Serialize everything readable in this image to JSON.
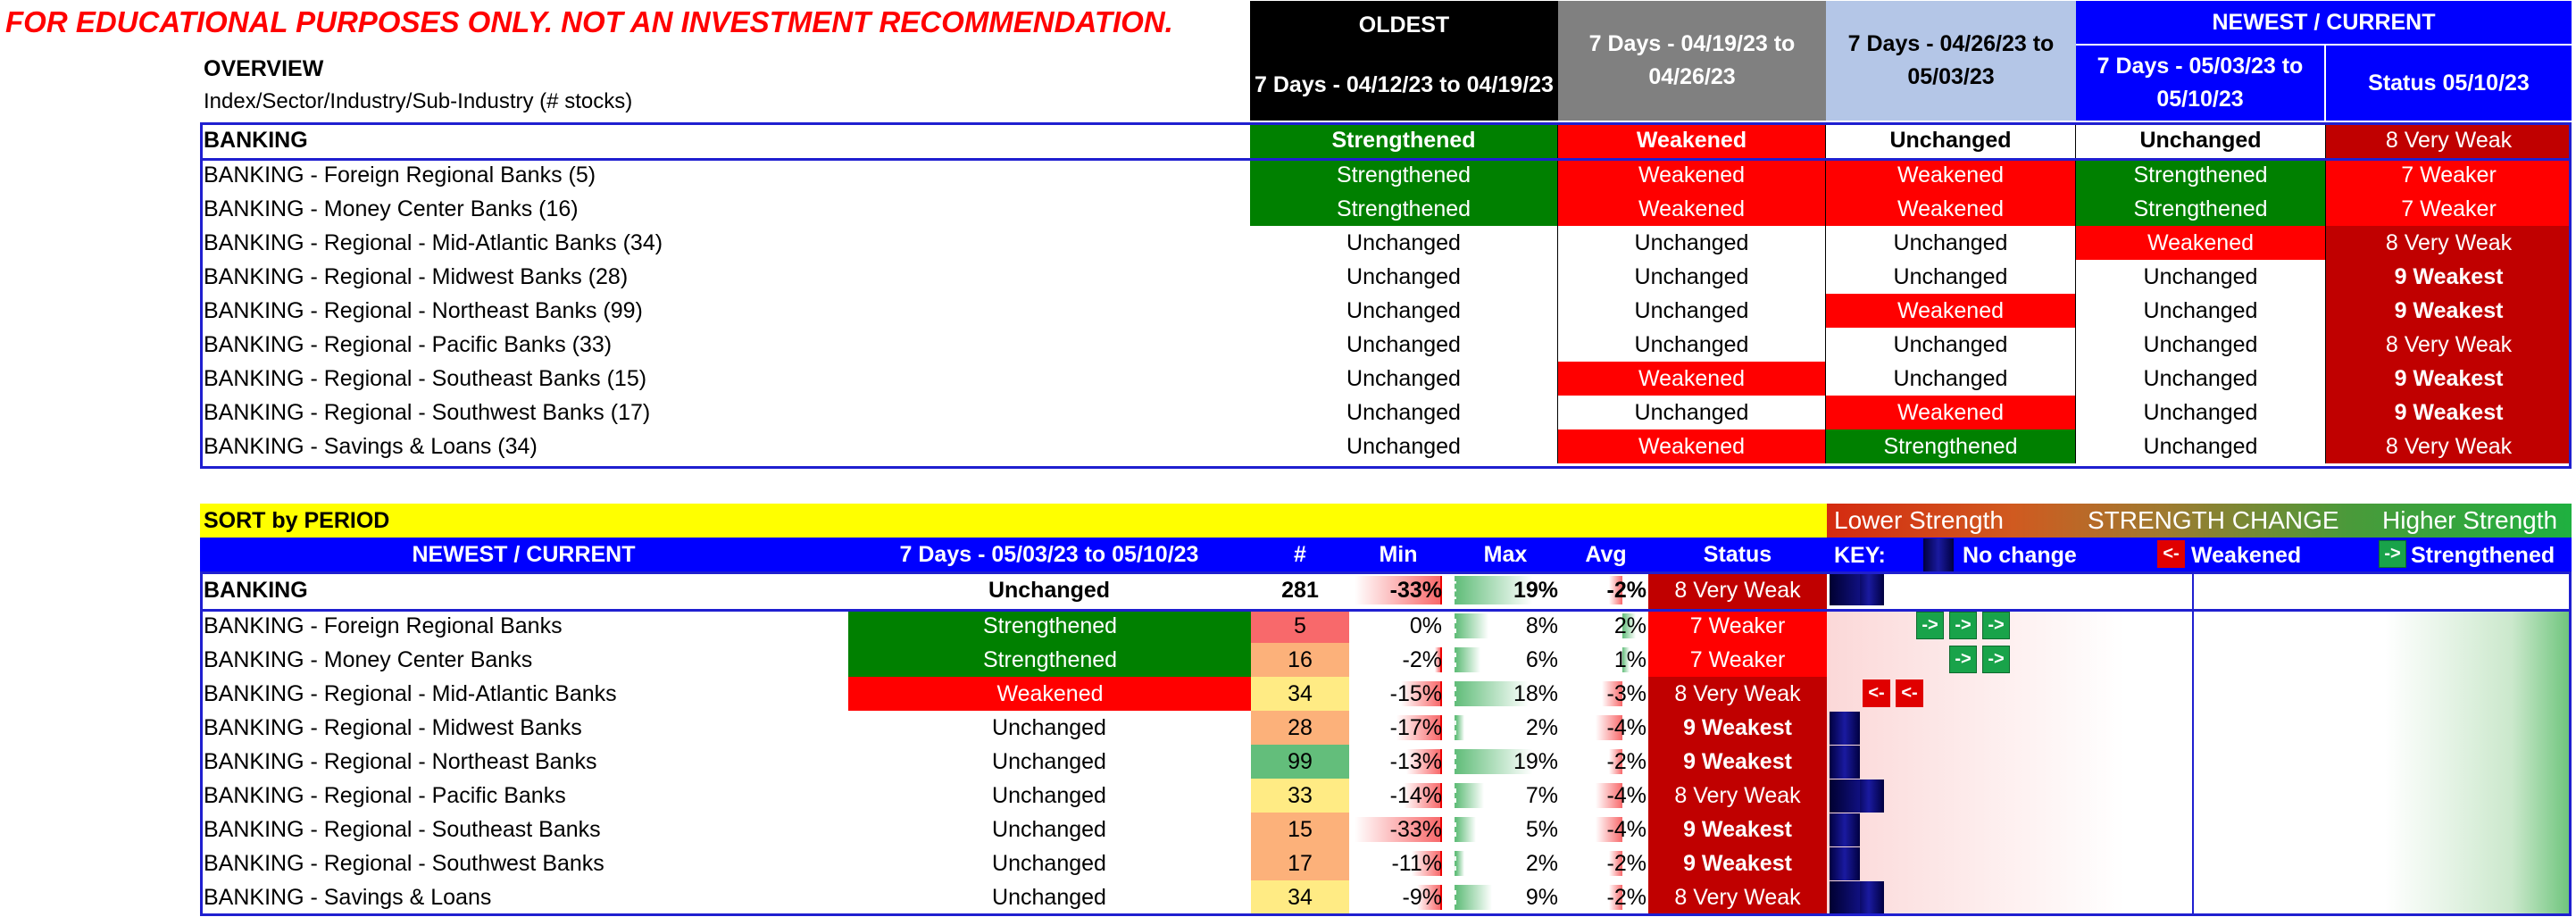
{
  "disclaimer": "FOR EDUCATIONAL PURPOSES ONLY. NOT AN INVESTMENT RECOMMENDATION.",
  "overview": {
    "title": "OVERVIEW",
    "subtitle": "Index/Sector/Industry/Sub-Industry (# stocks)",
    "oldest_label": "OLDEST",
    "newest_label": "NEWEST / CURRENT",
    "periods": [
      "7 Days - 04/12/23 to 04/19/23",
      "7 Days - 04/19/23 to 04/26/23",
      "7 Days - 04/26/23 to 05/03/23",
      "7 Days - 05/03/23 to 05/10/23"
    ],
    "status_header": "Status 05/10/23",
    "rows": [
      {
        "name": "BANKING",
        "p1": "Strengthened",
        "p2": "Weakened",
        "p3": "Unchanged",
        "p4": "Unchanged",
        "status": "8 Very Weak"
      },
      {
        "name": "BANKING - Foreign Regional Banks (5)",
        "p1": "Strengthened",
        "p2": "Weakened",
        "p3": "Weakened",
        "p4": "Strengthened",
        "status": "7 Weaker"
      },
      {
        "name": "BANKING - Money Center Banks (16)",
        "p1": "Strengthened",
        "p2": "Weakened",
        "p3": "Weakened",
        "p4": "Strengthened",
        "status": "7 Weaker"
      },
      {
        "name": "BANKING - Regional - Mid-Atlantic Banks (34)",
        "p1": "Unchanged",
        "p2": "Unchanged",
        "p3": "Unchanged",
        "p4": "Weakened",
        "status": "8 Very Weak"
      },
      {
        "name": "BANKING - Regional - Midwest Banks (28)",
        "p1": "Unchanged",
        "p2": "Unchanged",
        "p3": "Unchanged",
        "p4": "Unchanged",
        "status": "9 Weakest"
      },
      {
        "name": "BANKING - Regional - Northeast Banks (99)",
        "p1": "Unchanged",
        "p2": "Unchanged",
        "p3": "Weakened",
        "p4": "Unchanged",
        "status": "9 Weakest"
      },
      {
        "name": "BANKING - Regional - Pacific Banks (33)",
        "p1": "Unchanged",
        "p2": "Unchanged",
        "p3": "Unchanged",
        "p4": "Unchanged",
        "status": "8 Very Weak"
      },
      {
        "name": "BANKING - Regional - Southeast Banks (15)",
        "p1": "Unchanged",
        "p2": "Weakened",
        "p3": "Unchanged",
        "p4": "Unchanged",
        "status": "9 Weakest"
      },
      {
        "name": "BANKING - Regional - Southwest Banks (17)",
        "p1": "Unchanged",
        "p2": "Unchanged",
        "p3": "Weakened",
        "p4": "Unchanged",
        "status": "9 Weakest"
      },
      {
        "name": "BANKING - Savings & Loans (34)",
        "p1": "Unchanged",
        "p2": "Weakened",
        "p3": "Strengthened",
        "p4": "Unchanged",
        "status": "8 Very Weak"
      }
    ]
  },
  "sort": {
    "title": "SORT by PERIOD",
    "strength": {
      "lower": "Lower Strength",
      "change": "STRENGTH CHANGE",
      "higher": "Higher Strength"
    },
    "headers": {
      "name": "NEWEST / CURRENT",
      "period": "7 Days - 05/03/23 to 05/10/23",
      "count": "#",
      "min": "Min",
      "max": "Max",
      "avg": "Avg",
      "status": "Status"
    },
    "key": {
      "label": "KEY:",
      "no_change": "No change",
      "weakened_arrow": "<-",
      "weakened": "Weakened",
      "strengthened_arrow": "->",
      "strengthened": "Strengthened"
    },
    "rows": [
      {
        "name": "BANKING",
        "period": "Unchanged",
        "count": "281",
        "min": "-33%",
        "max": "19%",
        "avg": "-2%",
        "status": "8 Very Weak",
        "arrows": ""
      },
      {
        "name": "BANKING - Foreign Regional Banks",
        "period": "Strengthened",
        "count": "5",
        "min": "0%",
        "max": "8%",
        "avg": "2%",
        "status": "7 Weaker",
        "arrows": "->"
      },
      {
        "name": "BANKING - Money Center Banks",
        "period": "Strengthened",
        "count": "16",
        "min": "-2%",
        "max": "6%",
        "avg": "1%",
        "status": "7 Weaker",
        "arrows": "->"
      },
      {
        "name": "BANKING - Regional - Mid-Atlantic Banks",
        "period": "Weakened",
        "count": "34",
        "min": "-15%",
        "max": "18%",
        "avg": "-3%",
        "status": "8 Very Weak",
        "arrows": "<-"
      },
      {
        "name": "BANKING - Regional - Midwest Banks",
        "period": "Unchanged",
        "count": "28",
        "min": "-17%",
        "max": "2%",
        "avg": "-4%",
        "status": "9 Weakest",
        "arrows": ""
      },
      {
        "name": "BANKING - Regional - Northeast Banks",
        "period": "Unchanged",
        "count": "99",
        "min": "-13%",
        "max": "19%",
        "avg": "-2%",
        "status": "9 Weakest",
        "arrows": ""
      },
      {
        "name": "BANKING - Regional - Pacific Banks",
        "period": "Unchanged",
        "count": "33",
        "min": "-14%",
        "max": "7%",
        "avg": "-4%",
        "status": "8 Very Weak",
        "arrows": ""
      },
      {
        "name": "BANKING - Regional - Southeast Banks",
        "period": "Unchanged",
        "count": "15",
        "min": "-33%",
        "max": "5%",
        "avg": "-4%",
        "status": "9 Weakest",
        "arrows": ""
      },
      {
        "name": "BANKING - Regional - Southwest Banks",
        "period": "Unchanged",
        "count": "17",
        "min": "-11%",
        "max": "2%",
        "avg": "-2%",
        "status": "9 Weakest",
        "arrows": ""
      },
      {
        "name": "BANKING - Savings & Loans",
        "period": "Unchanged",
        "count": "34",
        "min": "-9%",
        "max": "9%",
        "avg": "-2%",
        "status": "8 Very Weak",
        "arrows": ""
      }
    ]
  },
  "colors": {
    "strengthened": "#008000",
    "weakened": "#ff0000",
    "unchanged": "#ffffff",
    "status_dark": "#c00000",
    "status_red": "#ff0000",
    "header_blue": "#0000ff",
    "sort_yellow": "#ffff00",
    "oldest_black": "#000000",
    "period2_gray": "#808080",
    "period3_lightblue": "#b4c6e7"
  }
}
